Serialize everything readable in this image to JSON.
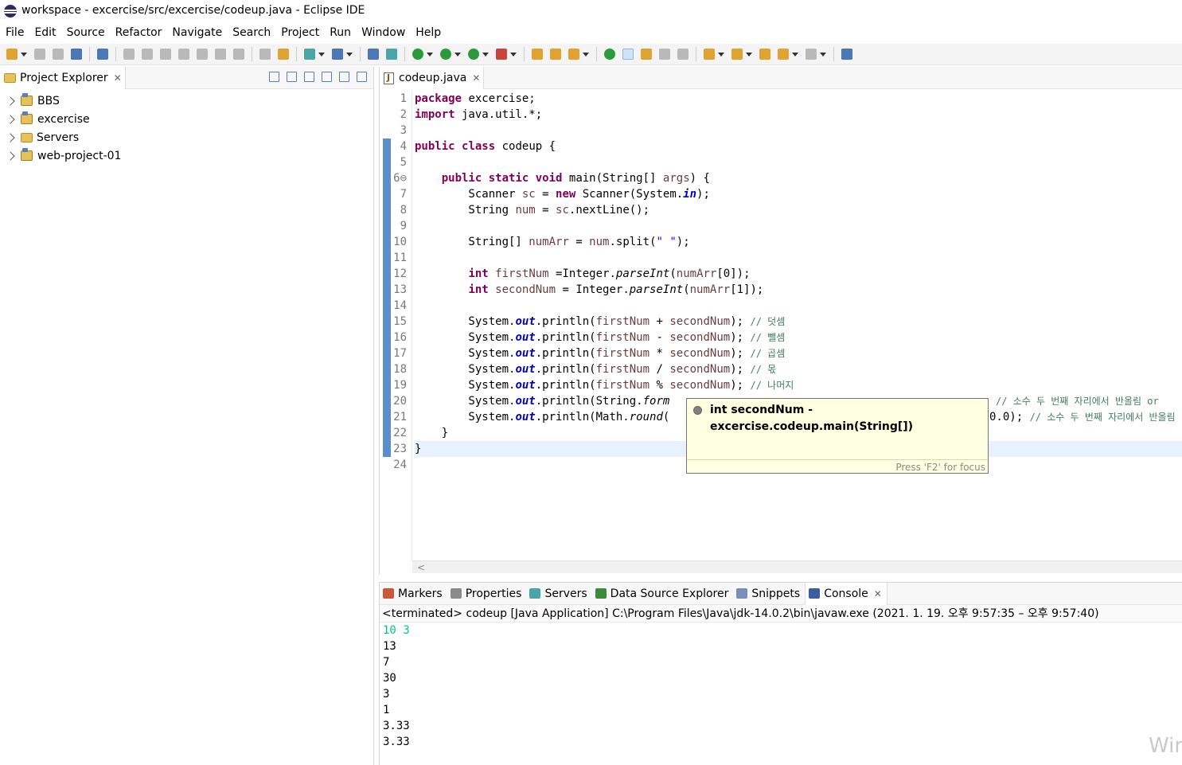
{
  "window": {
    "title": "workspace - excercise/src/excercise/codeup.java - Eclipse IDE"
  },
  "menu": [
    "File",
    "Edit",
    "Source",
    "Refactor",
    "Navigate",
    "Search",
    "Project",
    "Run",
    "Window",
    "Help"
  ],
  "explorer": {
    "tab_label": "Project Explorer",
    "items": [
      "BBS",
      "excercise",
      "Servers",
      "web-project-01"
    ]
  },
  "editor": {
    "tab_label": "codeup.java",
    "line_numbers": [
      "1",
      "2",
      "3",
      "4",
      "5",
      "6⊖",
      "7",
      "8",
      "9",
      "10",
      "11",
      "12",
      "13",
      "14",
      "15",
      "16",
      "17",
      "18",
      "19",
      "20",
      "21",
      "22",
      "23",
      "24"
    ],
    "lines": [
      "package excercise;",
      "import java.util.*;",
      "",
      "public class codeup {",
      "",
      "    public static void main(String[] args) {",
      "        Scanner sc = new Scanner(System.in);",
      "        String num = sc.nextLine();",
      "",
      "        String[] numArr = num.split(\" \");",
      "",
      "        int firstNum =Integer.parseInt(numArr[0]);",
      "        int secondNum = Integer.parseInt(numArr[1]);",
      "",
      "        System.out.println(firstNum + secondNum); // 덧셈",
      "        System.out.println(firstNum - secondNum); // 뺄셈",
      "        System.out.println(firstNum * secondNum); // 곱셈",
      "        System.out.println(firstNum / secondNum); // 몫",
      "        System.out.println(firstNum % secondNum); // 나머지",
      "        System.out.println(String.form",
      "        System.out.println(Math.round(",
      "    }",
      "}",
      ""
    ],
    "line20_tail": "// 소수 두 번째 자리에서 반올림 or",
    "line21_tail": "0.0); // 소수 두 번째 자리에서 반올림"
  },
  "tooltip": {
    "text": "int secondNum - excercise.codeup.main(String[])",
    "footer": "Press 'F2' for focus"
  },
  "bottom_panel": {
    "tabs": [
      "Markers",
      "Properties",
      "Servers",
      "Data Source Explorer",
      "Snippets",
      "Console"
    ],
    "active_tab": "Console",
    "status": "<terminated> codeup [Java Application] C:\\Program Files\\Java\\jdk-14.0.2\\bin\\javaw.exe  (2021. 1. 19. 오후 9:57:35 – 오후 9:57:40)",
    "console_input": "10 3",
    "console_output": [
      "13",
      "7",
      "30",
      "3",
      "1",
      "3.33",
      "3.33"
    ]
  },
  "watermark": "Win"
}
